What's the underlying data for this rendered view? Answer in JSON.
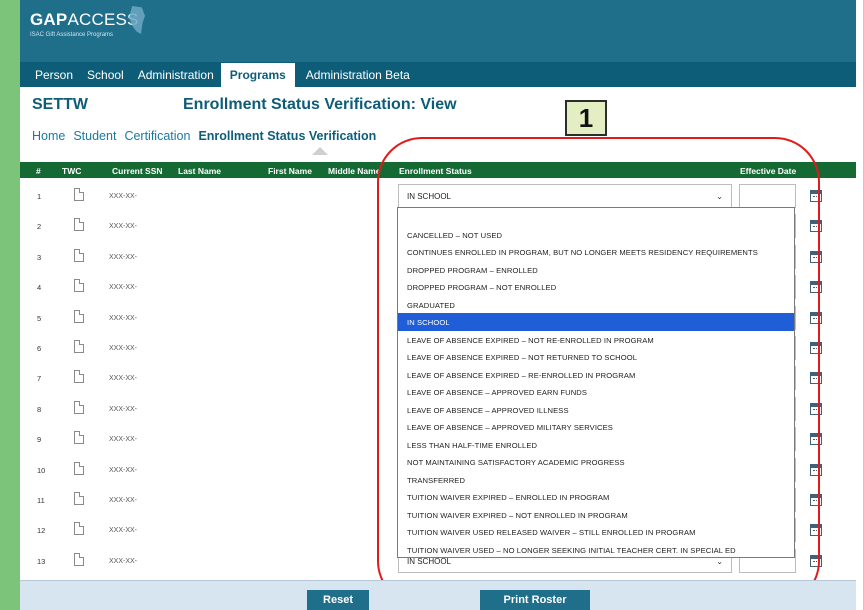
{
  "app": {
    "logo_bold": "GAP",
    "logo_light": "ACCESS",
    "logo_sub": "ISAC Gift Assistance Programs"
  },
  "tabs": [
    {
      "label": "Person"
    },
    {
      "label": "School"
    },
    {
      "label": "Administration"
    },
    {
      "label": "Programs",
      "active": true
    },
    {
      "label": "Administration Beta"
    }
  ],
  "school_code": "SETTW",
  "page_title": "Enrollment Status Verification: View",
  "breadcrumb": [
    "Home",
    "Student",
    "Certification",
    "Enrollment Status Verification"
  ],
  "annotation_badge": "1",
  "table": {
    "columns": [
      "#",
      "TWC",
      "Current SSN",
      "Last Name",
      "First Name",
      "Middle Name",
      "Enrollment Status",
      "Effective Date"
    ],
    "rows": [
      {
        "num": "1",
        "ssn": "XXX-XX-",
        "status": "IN SCHOOL"
      },
      {
        "num": "2",
        "ssn": "XXX-XX-"
      },
      {
        "num": "3",
        "ssn": "XXX-XX-"
      },
      {
        "num": "4",
        "ssn": "XXX-XX-"
      },
      {
        "num": "5",
        "ssn": "XXX-XX-"
      },
      {
        "num": "6",
        "ssn": "XXX-XX-"
      },
      {
        "num": "7",
        "ssn": "XXX-XX-"
      },
      {
        "num": "8",
        "ssn": "XXX-XX-"
      },
      {
        "num": "9",
        "ssn": "XXX-XX-"
      },
      {
        "num": "10",
        "ssn": "XXX-XX-"
      },
      {
        "num": "11",
        "ssn": "XXX-XX-"
      },
      {
        "num": "12",
        "ssn": "XXX-XX-"
      },
      {
        "num": "13",
        "ssn": "XXX-XX-",
        "status": "IN SCHOOL"
      }
    ]
  },
  "dropdown": {
    "selected": "IN SCHOOL",
    "options": [
      "",
      "CANCELLED – NOT USED",
      "CONTINUES ENROLLED IN PROGRAM, BUT NO LONGER MEETS RESIDENCY REQUIREMENTS",
      "DROPPED PROGRAM – ENROLLED",
      "DROPPED PROGRAM – NOT ENROLLED",
      "GRADUATED",
      "IN SCHOOL",
      "LEAVE OF ABSENCE EXPIRED – NOT RE-ENROLLED IN PROGRAM",
      "LEAVE OF ABSENCE EXPIRED – NOT RETURNED TO SCHOOL",
      "LEAVE OF ABSENCE EXPIRED – RE-ENROLLED IN PROGRAM",
      "LEAVE OF ABSENCE – APPROVED EARN FUNDS",
      "LEAVE OF ABSENCE – APPROVED ILLNESS",
      "LEAVE OF ABSENCE – APPROVED MILITARY SERVICES",
      "LESS THAN HALF-TIME ENROLLED",
      "NOT MAINTAINING SATISFACTORY ACADEMIC PROGRESS",
      "TRANSFERRED",
      "TUITION WAIVER EXPIRED – ENROLLED IN PROGRAM",
      "TUITION WAIVER EXPIRED – NOT ENROLLED IN PROGRAM",
      "TUITION WAIVER USED RELEASED WAIVER – STILL ENROLLED IN PROGRAM",
      "TUITION WAIVER USED – NO LONGER SEEKING INITIAL TEACHER CERT. IN SPECIAL ED"
    ]
  },
  "footer": {
    "reset_label": "Reset",
    "print_label": "Print Roster"
  },
  "colors": {
    "header": "#1f6f8b",
    "nav": "#0d5d79",
    "table_header": "#156a34",
    "selected_option": "#1f5ed6",
    "annotation_ring": "#e01b1b",
    "left_stripe": "#7cc47a"
  }
}
